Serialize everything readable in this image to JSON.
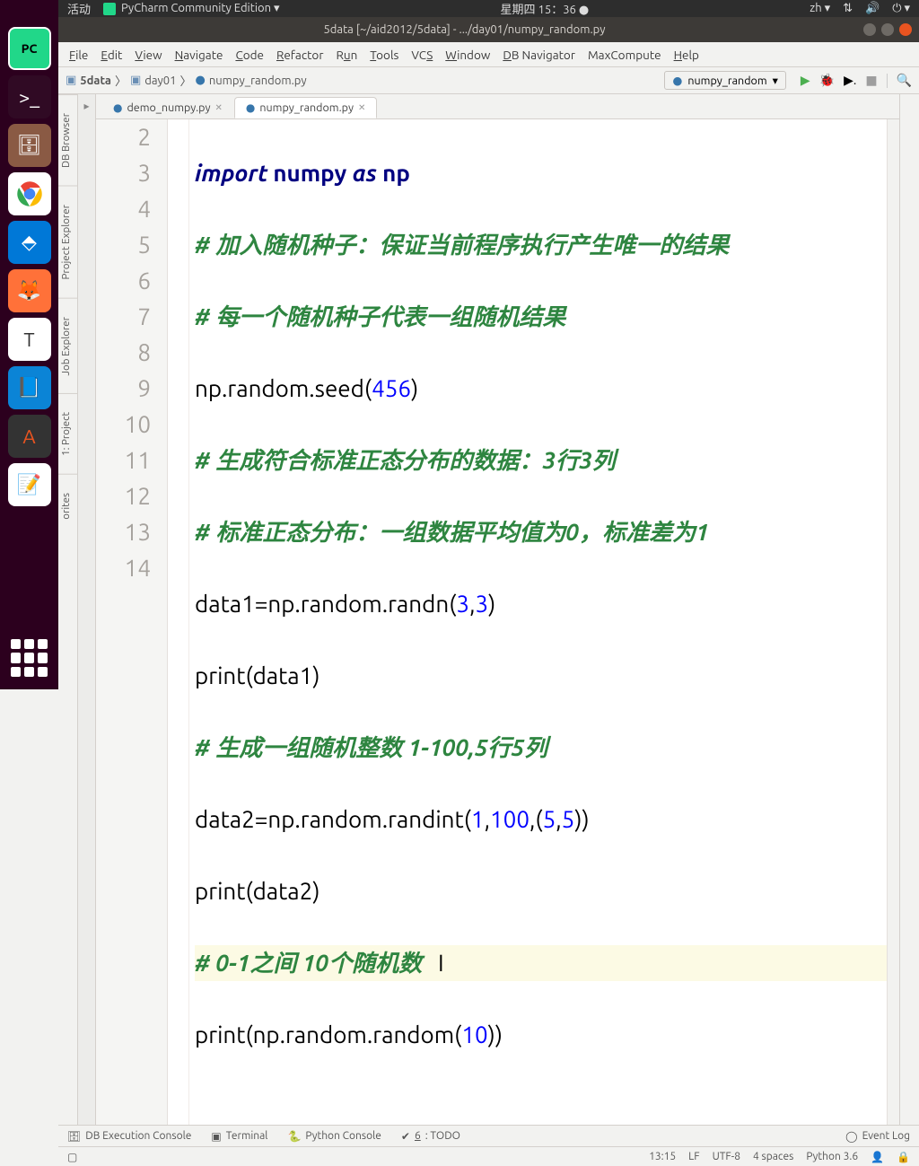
{
  "topbar": {
    "activities": "活动",
    "app_name": "PyCharm Community Edition ▾",
    "clock": "星期四 15：36 ●",
    "lang": "zh ▾"
  },
  "window": {
    "title": "5data [~/aid2012/5data] - .../day01/numpy_random.py"
  },
  "menu": {
    "file": "File",
    "edit": "Edit",
    "view": "View",
    "navigate": "Navigate",
    "code": "Code",
    "refactor": "Refactor",
    "run": "Run",
    "tools": "Tools",
    "vcs": "VCS",
    "window": "Window",
    "db": "DB Navigator",
    "maxcompute": "MaxCompute",
    "help": "Help"
  },
  "breadcrumbs": {
    "root": "5data",
    "folder": "day01",
    "file": "numpy_random.py"
  },
  "run_config": {
    "name": "numpy_random"
  },
  "side_tabs": {
    "db": "DB Browser",
    "project": "Project Explorer",
    "job": "Job Explorer",
    "proj1": "1: Project",
    "fav": "orites"
  },
  "tabs": {
    "t1": "demo_numpy.py",
    "t2": "numpy_random.py"
  },
  "code": {
    "l2": {
      "a": "import",
      "b": " numpy ",
      "c": "as",
      "d": " np"
    },
    "l3": "# 加入随机种子：保证当前程序执行产生唯一的结果",
    "l4": "# 每一个随机种子代表一组随机结果",
    "l5": {
      "a": "np.random.seed(",
      "n": "456",
      "b": ")"
    },
    "l6": "# 生成符合标准正态分布的数据：3行3列",
    "l7": "# 标准正态分布：一组数据平均值为0，标准差为1",
    "l8": {
      "a": "data1=np.random.randn(",
      "n1": "3",
      "c": ",",
      "n2": "3",
      "b": ")"
    },
    "l9": {
      "a": "print",
      "b": "(data1)"
    },
    "l10": "# 生成一组随机整数 1-100,5行5列",
    "l11": {
      "a": "data2=np.random.randint(",
      "n1": "1",
      "c1": ",",
      "n2": "100",
      "c2": ",(",
      "n3": "5",
      "c3": ",",
      "n4": "5",
      "b": "))"
    },
    "l12": {
      "a": "print",
      "b": "(data2)"
    },
    "l13": {
      "a": "# 0-1之间 ",
      "b": "10",
      "c": "个随机数"
    },
    "l14": {
      "a": "print",
      "b": "(np.random.random(",
      "n": "10",
      "c": "))"
    }
  },
  "line_numbers": [
    "2",
    "3",
    "4",
    "5",
    "6",
    "7",
    "8",
    "9",
    "10",
    "11",
    "12",
    "13",
    "14"
  ],
  "bottom": {
    "db": "DB Execution Console",
    "term": "Terminal",
    "pyc": "Python Console",
    "todo": "6: TODO",
    "log": "Event Log"
  },
  "status": {
    "pos": "13:15",
    "lf": "LF",
    "enc": "UTF-8",
    "indent": "4 spaces",
    "py": "Python 3.6"
  }
}
